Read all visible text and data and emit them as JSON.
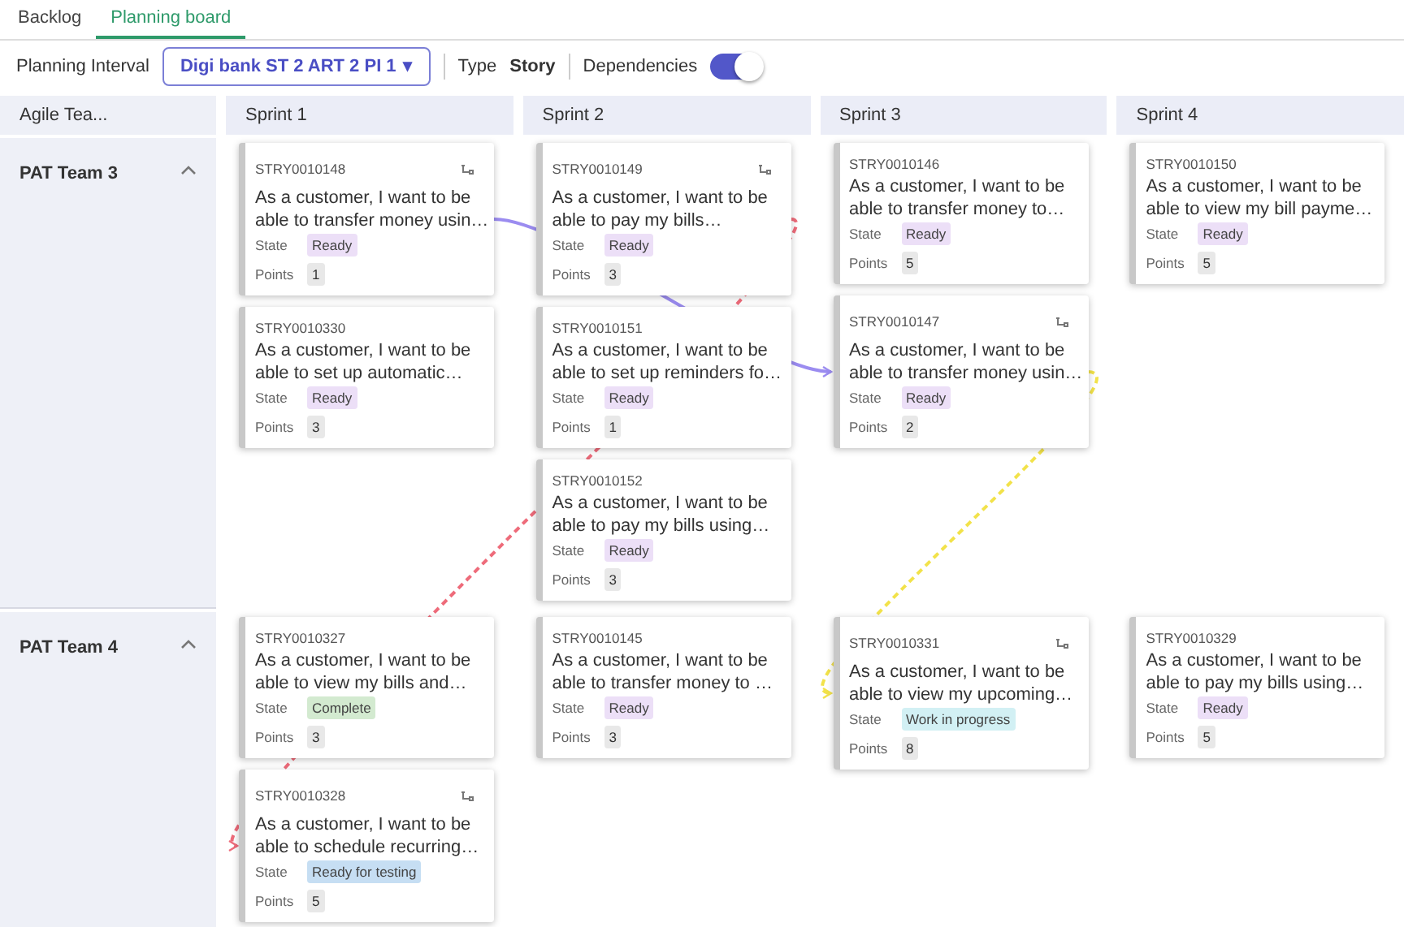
{
  "tabs": [
    {
      "label": "Backlog",
      "selected": false
    },
    {
      "label": "Planning board",
      "selected": true
    }
  ],
  "filters": {
    "interval_label": "Planning Interval",
    "interval_value": "Digi bank ST 2 ART 2 PI 1",
    "caret": "▾",
    "type_label": "Type",
    "type_value": "Story",
    "dependencies_label": "Dependencies",
    "dependencies_on": true
  },
  "board": {
    "team_header": "Agile Tea...",
    "sprints": [
      "Sprint 1",
      "Sprint 2",
      "Sprint 3",
      "Sprint 4"
    ],
    "teams": [
      {
        "name": "PAT Team 3",
        "expanded": true,
        "sprints": [
          [
            {
              "id": "STRY0010148",
              "dependency_icon": true,
              "links_out": [
                {
                  "color": "#9b8cf0",
                  "kind": "solid"
                }
              ],
              "title": "As a customer, I want to be able to transfer money usin…",
              "state_label": "State",
              "state": {
                "label": "Ready",
                "color": "#ecdff7"
              },
              "points_label": "Points",
              "points": "1"
            },
            {
              "id": "STRY0010330",
              "dependency_icon": false,
              "title": "As a customer, I want to be able to set up automatic…",
              "state_label": "State",
              "state": {
                "label": "Ready",
                "color": "#ecdff7"
              },
              "points_label": "Points",
              "points": "3"
            }
          ],
          [
            {
              "id": "STRY0010149",
              "dependency_icon": true,
              "links_out": [
                {
                  "color": "#ee6b7a",
                  "kind": "dashed"
                }
              ],
              "title": "As a customer, I want to be able to pay my bills…",
              "state_label": "State",
              "state": {
                "label": "Ready",
                "color": "#ecdff7"
              },
              "points_label": "Points",
              "points": "3"
            },
            {
              "id": "STRY0010151",
              "dependency_icon": false,
              "title": "As a customer, I want to be able to set up reminders fo…",
              "state_label": "State",
              "state": {
                "label": "Ready",
                "color": "#ecdff7"
              },
              "points_label": "Points",
              "points": "1"
            },
            {
              "id": "STRY0010152",
              "dependency_icon": false,
              "title": "As a customer, I want to be able to pay my bills using…",
              "state_label": "State",
              "state": {
                "label": "Ready",
                "color": "#ecdff7"
              },
              "points_label": "Points",
              "points": "3"
            }
          ],
          [
            {
              "id": "STRY0010146",
              "dependency_icon": false,
              "title": "As a customer, I want to be able to transfer money to…",
              "state_label": "State",
              "state": {
                "label": "Ready",
                "color": "#ecdff7"
              },
              "points_label": "Points",
              "points": "5"
            },
            {
              "id": "STRY0010147",
              "dependency_icon": true,
              "links_in": [
                {
                  "color": "#9b8cf0"
                }
              ],
              "links_out": [
                {
                  "color": "#f2e24a",
                  "kind": "dashed"
                }
              ],
              "title": "As a customer, I want to be able to transfer money usin…",
              "state_label": "State",
              "state": {
                "label": "Ready",
                "color": "#ecdff7"
              },
              "points_label": "Points",
              "points": "2"
            }
          ],
          [
            {
              "id": "STRY0010150",
              "dependency_icon": false,
              "title": "As a customer, I want to be able to view my bill payme…",
              "state_label": "State",
              "state": {
                "label": "Ready",
                "color": "#ecdff7"
              },
              "points_label": "Points",
              "points": "5"
            }
          ]
        ]
      },
      {
        "name": "PAT Team 4",
        "expanded": true,
        "sprints": [
          [
            {
              "id": "STRY0010327",
              "dependency_icon": false,
              "title": "As a customer, I want to be able to view my bills and…",
              "state_label": "State",
              "state": {
                "label": "Complete",
                "color": "#d3ead0"
              },
              "points_label": "Points",
              "points": "3"
            },
            {
              "id": "STRY0010328",
              "dependency_icon": true,
              "links_in": [
                {
                  "color": "#ee6b7a"
                }
              ],
              "title": "As a customer, I want to be able to schedule recurring…",
              "state_label": "State",
              "state": {
                "label": "Ready for testing",
                "color": "#c6def3"
              },
              "points_label": "Points",
              "points": "5"
            }
          ],
          [
            {
              "id": "STRY0010145",
              "dependency_icon": false,
              "title": "As a customer, I want to be able to transfer money to …",
              "state_label": "State",
              "state": {
                "label": "Ready",
                "color": "#ecdff7"
              },
              "points_label": "Points",
              "points": "3"
            }
          ],
          [
            {
              "id": "STRY0010331",
              "dependency_icon": true,
              "links_in": [
                {
                  "color": "#f2e24a"
                }
              ],
              "title": "As a customer, I want to be able to view my upcoming…",
              "state_label": "State",
              "state": {
                "label": "Work in progress",
                "color": "#d2f0f4"
              },
              "points_label": "Points",
              "points": "8"
            }
          ],
          [
            {
              "id": "STRY0010329",
              "dependency_icon": false,
              "title": "As a customer, I want to be able to pay my bills using…",
              "state_label": "State",
              "state": {
                "label": "Ready",
                "color": "#ecdff7"
              },
              "points_label": "Points",
              "points": "5"
            }
          ]
        ]
      }
    ]
  }
}
